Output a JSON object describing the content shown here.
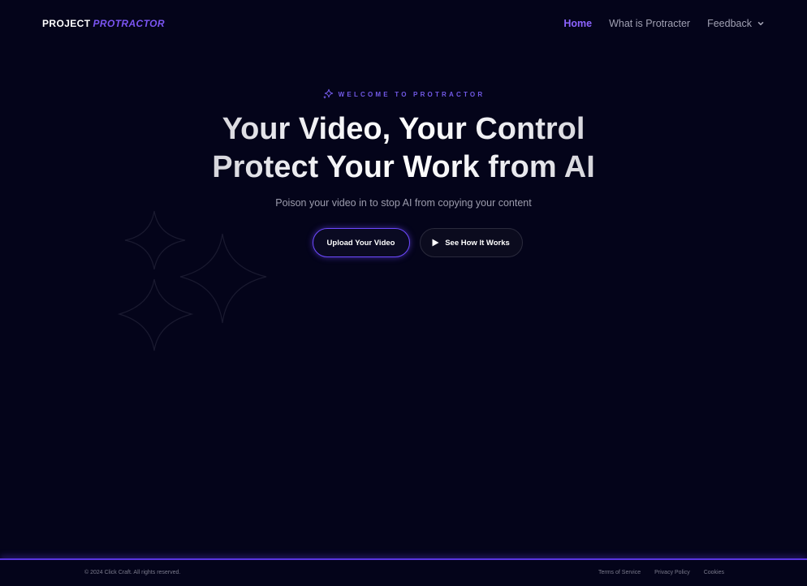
{
  "header": {
    "logo_primary": "PROJECT",
    "logo_accent": "PROTRACTOR",
    "nav": [
      {
        "label": "Home",
        "active": true
      },
      {
        "label": "What is Protracter",
        "active": false
      },
      {
        "label": "Feedback",
        "active": false,
        "has_dropdown": true
      }
    ]
  },
  "hero": {
    "eyebrow": "WELCOME TO PROTRACTOR",
    "headline_line1": "Your Video, Your Control",
    "headline_line2": "Protect Your Work from AI",
    "subtitle": "Poison your video in to stop AI from copying your content",
    "primary_button": "Upload Your Video",
    "secondary_button": "See How It Works"
  },
  "footer": {
    "copyright": "© 2024 Click Craft. All rights reserved.",
    "links": [
      "Terms of Service",
      "Privacy Policy",
      "Cookies"
    ]
  },
  "icons": {
    "eyebrow": "sparkle-icon",
    "dropdown": "chevron-down-icon",
    "play": "play-icon",
    "decoration": "sparkles-decoration"
  },
  "colors": {
    "background": "#04041a",
    "accent": "#7b55f2",
    "active_nav": "#8c63ff",
    "footer_border": "#5a36e0"
  }
}
